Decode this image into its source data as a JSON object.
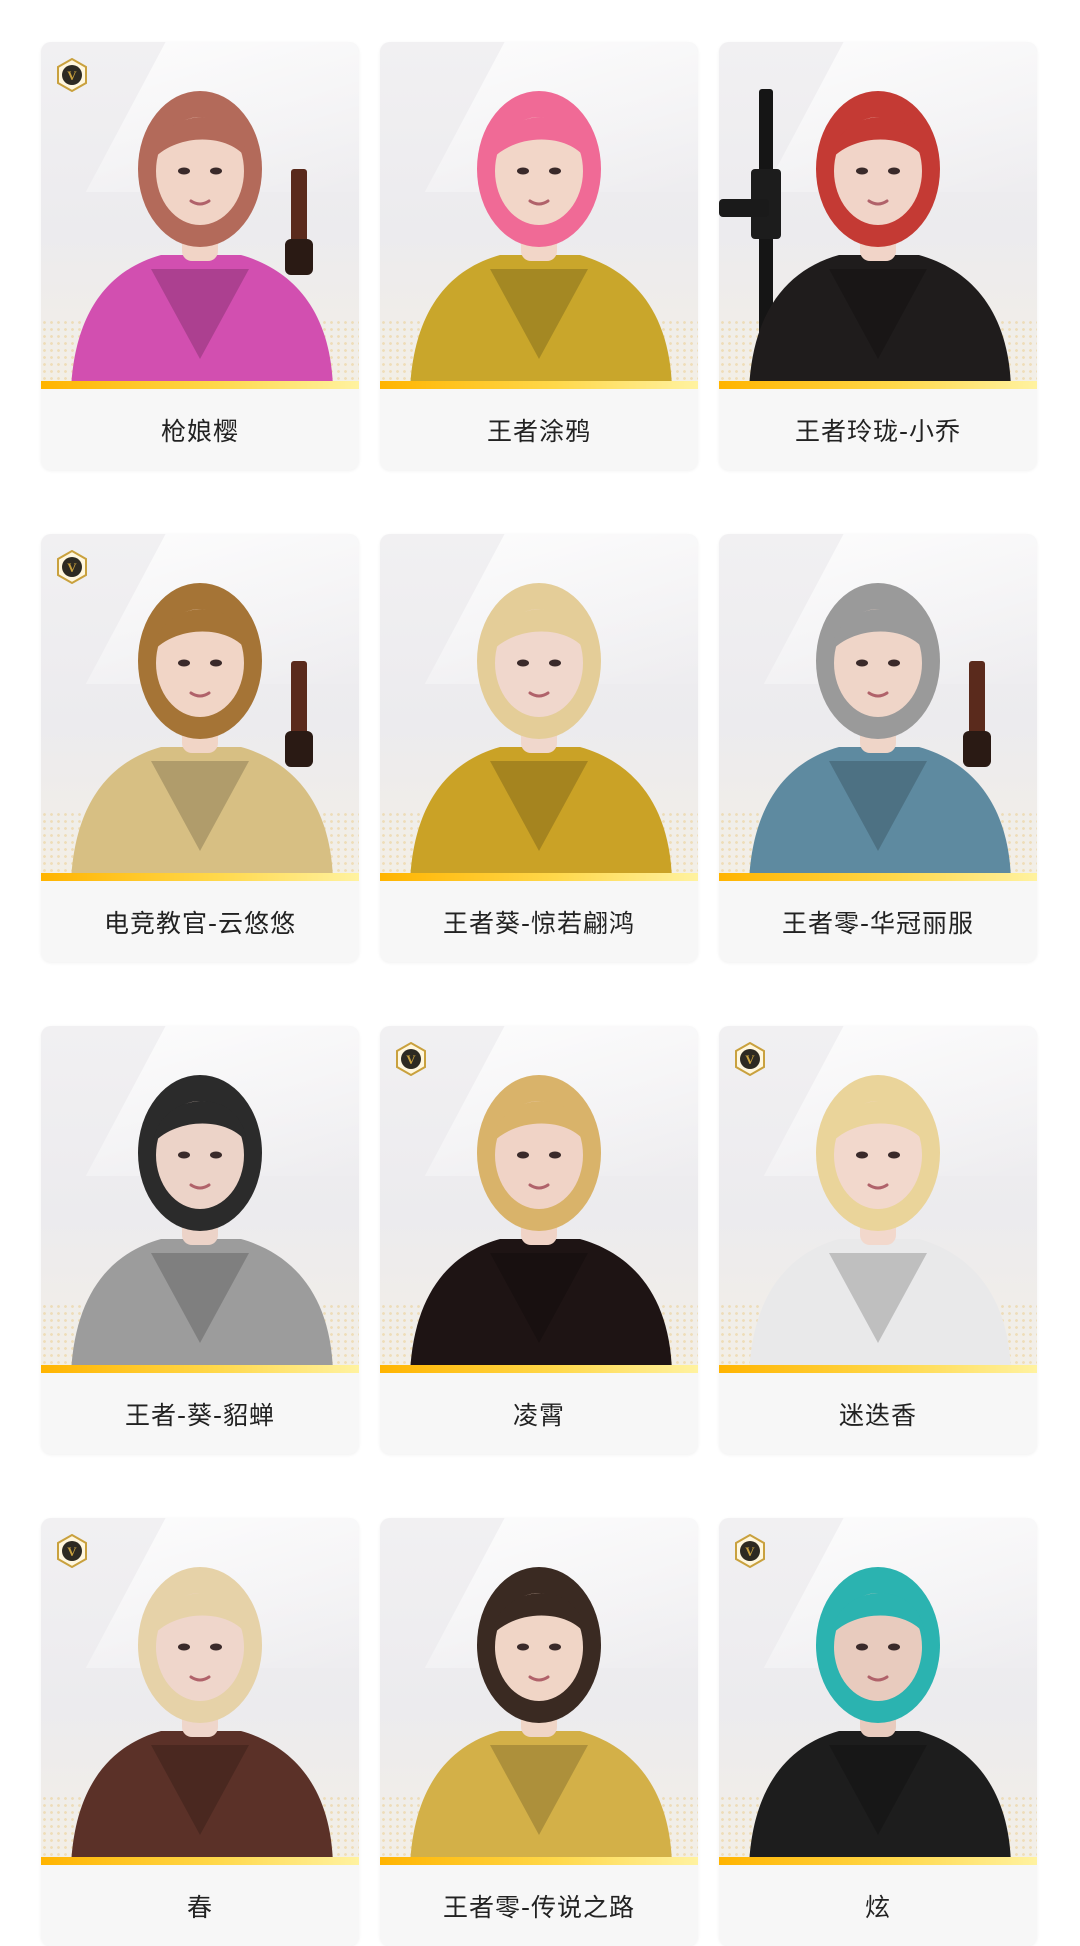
{
  "colors": {
    "accent_strip": "#ffc21a",
    "badge_gold": "#c9a13e",
    "card_bg": "#f7f7f7",
    "label_text": "#222222"
  },
  "cards": [
    {
      "name": "枪娘樱",
      "vip": true,
      "hair": "#b36a5a",
      "outfit": "#d24fb0",
      "skin": "#f1d4c6",
      "weapon": "pistol"
    },
    {
      "name": "王者涂鸦",
      "vip": false,
      "hair": "#f06a96",
      "outfit": "#c9a62b",
      "skin": "#f2d6c8",
      "weapon": "none"
    },
    {
      "name": "王者玲珑-小乔",
      "vip": false,
      "hair": "#c43a34",
      "outfit": "#1f1c1c",
      "skin": "#f1d4c8",
      "weapon": "rifle"
    },
    {
      "name": "电竞教官-云悠悠",
      "vip": true,
      "hair": "#a57436",
      "outfit": "#d7bf83",
      "skin": "#f1d5c6",
      "weapon": "pistol"
    },
    {
      "name": "王者葵-惊若翩鸿",
      "vip": false,
      "hair": "#e4cd98",
      "outfit": "#caa226",
      "skin": "#f0d7cc",
      "weapon": "none"
    },
    {
      "name": "王者零-华冠丽服",
      "vip": false,
      "hair": "#9a9a9a",
      "outfit": "#5e8aa0",
      "skin": "#efd5c8",
      "weapon": "pistol"
    },
    {
      "name": "王者-葵-貂蝉",
      "vip": false,
      "hair": "#2b2b2b",
      "outfit": "#9c9c9c",
      "skin": "#ecd3c8",
      "weapon": "none"
    },
    {
      "name": "凌霄",
      "vip": true,
      "hair": "#d9b36a",
      "outfit": "#1e1414",
      "skin": "#f0d3c6",
      "weapon": "none"
    },
    {
      "name": "迷迭香",
      "vip": true,
      "hair": "#ead49a",
      "outfit": "#e9e9ea",
      "skin": "#f2d8cc",
      "weapon": "none"
    },
    {
      "name": "春",
      "vip": true,
      "hair": "#e6d2a8",
      "outfit": "#5b3128",
      "skin": "#efd6cb",
      "weapon": "none"
    },
    {
      "name": "王者零-传说之路",
      "vip": false,
      "hair": "#3a2a22",
      "outfit": "#d3b048",
      "skin": "#f0d5c6",
      "weapon": "none"
    },
    {
      "name": "炫",
      "vip": true,
      "hair": "#2bb3b0",
      "outfit": "#1d1d1d",
      "skin": "#e8cbbe",
      "weapon": "none"
    }
  ]
}
